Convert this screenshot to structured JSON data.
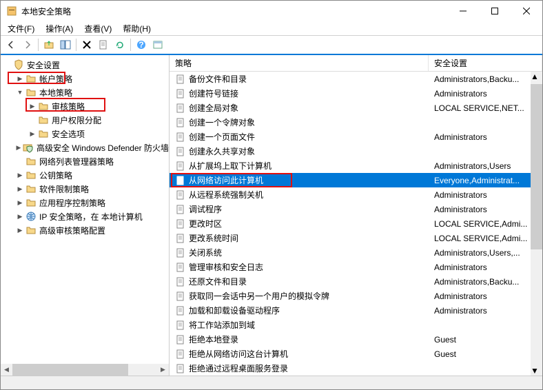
{
  "window": {
    "title": "本地安全策略"
  },
  "menu": {
    "file": "文件(F)",
    "action": "操作(A)",
    "view": "查看(V)",
    "help": "帮助(H)"
  },
  "tree": {
    "root": "安全设置",
    "items": [
      {
        "indent": 1,
        "expand": "▶",
        "label": "帐户策略"
      },
      {
        "indent": 1,
        "expand": "▼",
        "label": "本地策略",
        "hl": true
      },
      {
        "indent": 2,
        "expand": "▶",
        "label": "审核策略"
      },
      {
        "indent": 2,
        "expand": "",
        "label": "用户权限分配",
        "hl": true,
        "selectedish": true
      },
      {
        "indent": 2,
        "expand": "▶",
        "label": "安全选项"
      },
      {
        "indent": 1,
        "expand": "▶",
        "label": "高级安全 Windows Defender 防火墙",
        "shield": true
      },
      {
        "indent": 1,
        "expand": "",
        "label": "网络列表管理器策略"
      },
      {
        "indent": 1,
        "expand": "▶",
        "label": "公钥策略"
      },
      {
        "indent": 1,
        "expand": "▶",
        "label": "软件限制策略"
      },
      {
        "indent": 1,
        "expand": "▶",
        "label": "应用程序控制策略"
      },
      {
        "indent": 1,
        "expand": "▶",
        "label": "IP 安全策略，在 本地计算机",
        "net": true
      },
      {
        "indent": 1,
        "expand": "▶",
        "label": "高级审核策略配置"
      }
    ]
  },
  "list": {
    "header_policy": "策略",
    "header_setting": "安全设置",
    "rows": [
      {
        "name": "备份文件和目录",
        "setting": "Administrators,Backu..."
      },
      {
        "name": "创建符号链接",
        "setting": "Administrators"
      },
      {
        "name": "创建全局对象",
        "setting": "LOCAL SERVICE,NET..."
      },
      {
        "name": "创建一个令牌对象",
        "setting": ""
      },
      {
        "name": "创建一个页面文件",
        "setting": "Administrators"
      },
      {
        "name": "创建永久共享对象",
        "setting": ""
      },
      {
        "name": "从扩展坞上取下计算机",
        "setting": "Administrators,Users"
      },
      {
        "name": "从网络访问此计算机",
        "setting": "Everyone,Administrat...",
        "selected": true,
        "hl": true
      },
      {
        "name": "从远程系统强制关机",
        "setting": "Administrators"
      },
      {
        "name": "调试程序",
        "setting": "Administrators"
      },
      {
        "name": "更改时区",
        "setting": "LOCAL SERVICE,Admi..."
      },
      {
        "name": "更改系统时间",
        "setting": "LOCAL SERVICE,Admi..."
      },
      {
        "name": "关闭系统",
        "setting": "Administrators,Users,..."
      },
      {
        "name": "管理审核和安全日志",
        "setting": "Administrators"
      },
      {
        "name": "还原文件和目录",
        "setting": "Administrators,Backu..."
      },
      {
        "name": "获取同一会话中另一个用户的模拟令牌",
        "setting": "Administrators"
      },
      {
        "name": "加载和卸载设备驱动程序",
        "setting": "Administrators"
      },
      {
        "name": "将工作站添加到域",
        "setting": ""
      },
      {
        "name": "拒绝本地登录",
        "setting": "Guest"
      },
      {
        "name": "拒绝从网络访问这台计算机",
        "setting": "Guest"
      },
      {
        "name": "拒绝通过远程桌面服务登录",
        "setting": ""
      }
    ]
  }
}
